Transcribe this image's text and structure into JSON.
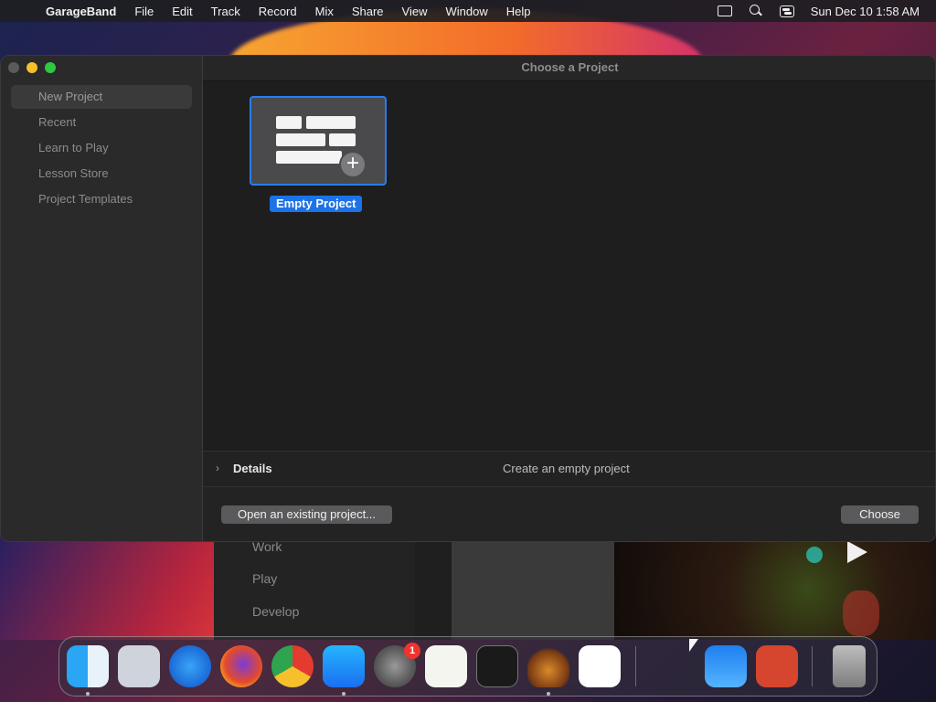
{
  "menubar": {
    "app_name": "GarageBand",
    "items": [
      "File",
      "Edit",
      "Track",
      "Record",
      "Mix",
      "Share",
      "View",
      "Window",
      "Help"
    ],
    "datetime": "Sun Dec 10  1:58 AM"
  },
  "background_window": {
    "items": [
      "Work",
      "Play",
      "Develop"
    ]
  },
  "dialog": {
    "title": "Choose a Project",
    "sidebar": {
      "items": [
        "New Project",
        "Recent",
        "Learn to Play",
        "Lesson Store",
        "Project Templates"
      ],
      "selected": "New Project"
    },
    "template": {
      "label": "Empty Project"
    },
    "details": {
      "label": "Details",
      "description": "Create an empty project"
    },
    "buttons": {
      "open_existing": "Open an existing project...",
      "choose": "Choose"
    }
  },
  "dock": {
    "badges": {
      "settings": "1"
    },
    "icons": [
      "finder-icon",
      "launchpad-icon",
      "safari-icon",
      "firefox-icon",
      "chrome-icon",
      "app-store-icon",
      "system-settings-icon",
      "textedit-icon",
      "terminal-icon",
      "garageband-icon",
      "vscode-icon",
      "weather-icon",
      "remote-desktop-icon",
      "trash-icon"
    ]
  },
  "colors": {
    "accent": "#2a7cf6",
    "traffic_minimize": "#f6be2f",
    "traffic_zoom": "#2fc840"
  }
}
